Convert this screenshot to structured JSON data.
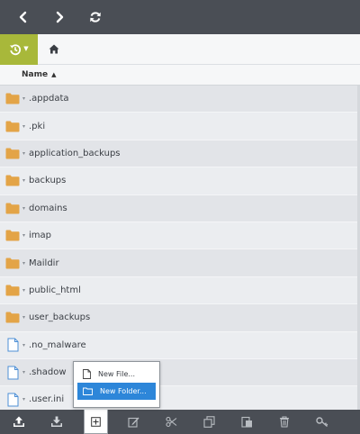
{
  "toolbar_top": {
    "back_icon": "chevron-left-icon",
    "forward_icon": "chevron-right-icon",
    "refresh_icon": "refresh-icon"
  },
  "pathbar": {
    "history_icon": "history-icon",
    "home_icon": "home-icon"
  },
  "columns": {
    "name_label": "Name"
  },
  "files": [
    {
      "name": ".appdata",
      "type": "folder"
    },
    {
      "name": ".pki",
      "type": "folder"
    },
    {
      "name": "application_backups",
      "type": "folder"
    },
    {
      "name": "backups",
      "type": "folder"
    },
    {
      "name": "domains",
      "type": "folder"
    },
    {
      "name": "imap",
      "type": "folder"
    },
    {
      "name": "Maildir",
      "type": "folder"
    },
    {
      "name": "public_html",
      "type": "folder"
    },
    {
      "name": "user_backups",
      "type": "folder"
    },
    {
      "name": ".no_malware",
      "type": "file"
    },
    {
      "name": ".shadow",
      "type": "file"
    },
    {
      "name": ".user.ini",
      "type": "file"
    }
  ],
  "context_menu": {
    "items": [
      {
        "label": "New File...",
        "icon": "file-icon",
        "active": false
      },
      {
        "label": "New Folder...",
        "icon": "folder-outline-icon",
        "active": true
      }
    ]
  },
  "bottom_toolbar": {
    "buttons": [
      "upload-icon",
      "download-icon",
      "new-icon",
      "edit-icon",
      "cut-icon",
      "copy-icon",
      "paste-icon",
      "delete-icon",
      "permissions-icon"
    ]
  },
  "colors": {
    "topbar": "#4a4e55",
    "accent_green": "#a8b83a",
    "folder": "#e3a447",
    "selection": "#2d86d9"
  }
}
